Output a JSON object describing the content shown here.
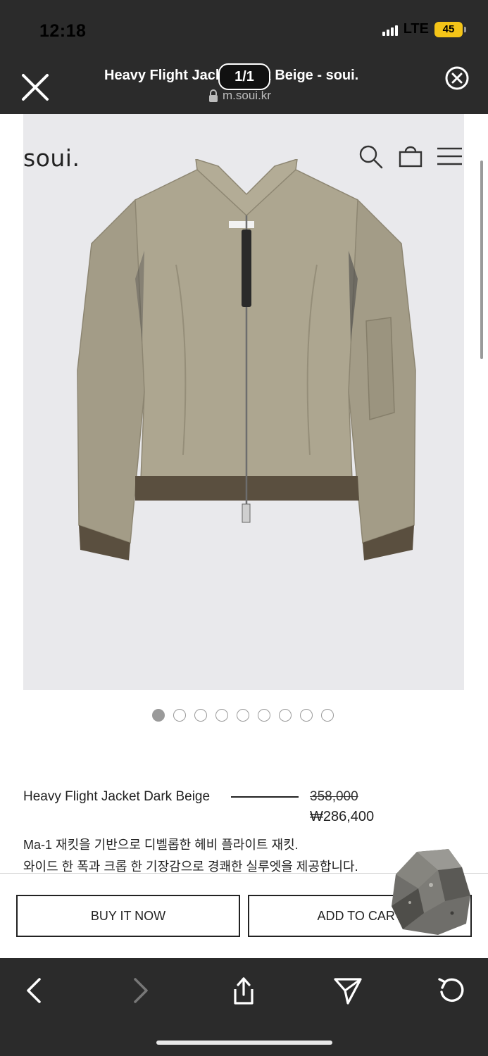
{
  "status_bar": {
    "time": "12:18",
    "network": "LTE",
    "battery": "45"
  },
  "browser": {
    "page_title": "Heavy Flight Jacket Dark Beige - soui.",
    "url": "m.soui.kr",
    "image_counter": "1/1"
  },
  "header": {
    "logo": "soui."
  },
  "gallery": {
    "total_slides": 9,
    "active_slide": 1
  },
  "product": {
    "name": "Heavy Flight Jacket Dark Beige",
    "original_price": "358,000",
    "sale_price": "₩286,400",
    "description_line1": "Ma-1 재킷을 기반으로 디벨롭한 헤비 플라이트 재킷.",
    "description_line2": "와이드 한 폭과 크롭 한 기장감으로 경쾌한 실루엣을 제공합니다."
  },
  "actions": {
    "buy_now": "BUY IT NOW",
    "add_to_cart": "ADD TO CART"
  },
  "colors": {
    "chrome": "#2b2b2b",
    "jacket": "#a39c87",
    "rib": "#5a4f3f",
    "hero_bg": "#e9e9ec",
    "battery": "#f5c518"
  },
  "icons": [
    "close-icon",
    "lock-icon",
    "circle-close-icon",
    "search-icon",
    "cart-icon",
    "menu-icon",
    "back-icon",
    "forward-icon",
    "share-icon",
    "send-icon",
    "reload-icon"
  ]
}
